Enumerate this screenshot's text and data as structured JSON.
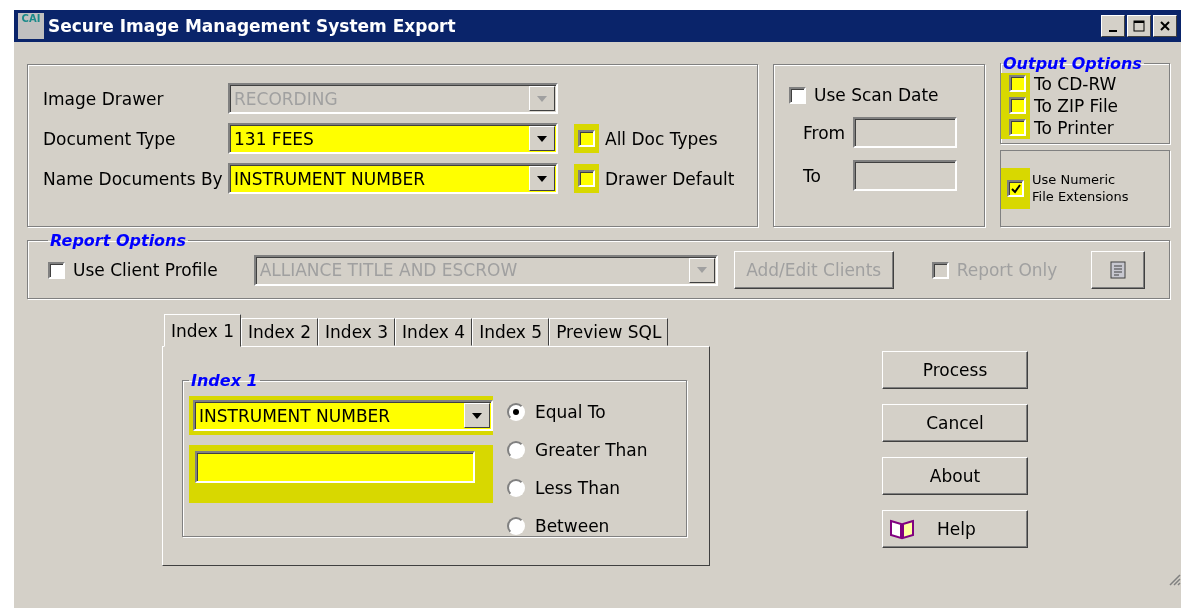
{
  "window": {
    "title": "Secure Image Management System Export",
    "app_icon_text": "CAI"
  },
  "document_fields": [
    {
      "label": "Image Drawer",
      "value": "RECORDING",
      "disabled": true,
      "highlighted": false
    },
    {
      "label": "Document Type",
      "value": "131 FEES",
      "disabled": false,
      "highlighted": true,
      "checkbox": {
        "label": "All Doc Types",
        "checked": false,
        "highlighted": true
      }
    },
    {
      "label": "Name Documents By",
      "value": "INSTRUMENT NUMBER",
      "disabled": false,
      "highlighted": true,
      "checkbox": {
        "label": "Drawer Default",
        "checked": false,
        "highlighted": true
      }
    }
  ],
  "scan_date": {
    "label": "Use Scan Date",
    "checked": false,
    "from_label": "From",
    "to_label": "To"
  },
  "output_options": {
    "title": "Output Options",
    "options": [
      {
        "label": "To CD-RW",
        "checked": false,
        "highlighted": true
      },
      {
        "label": "To ZIP File",
        "checked": false,
        "highlighted": true
      },
      {
        "label": "To Printer",
        "checked": false,
        "highlighted": true
      }
    ],
    "numeric_extensions": {
      "label": "Use Numeric File Extensions",
      "checked": true,
      "highlighted": true
    }
  },
  "report_options": {
    "title": "Report Options",
    "use_client_profile": {
      "label": "Use Client Profile",
      "checked": false,
      "disabled": false
    },
    "client": {
      "value": "ALLIANCE TITLE AND ESCROW",
      "disabled": true
    },
    "add_edit_button": {
      "label": "Add/Edit Clients",
      "disabled": true
    },
    "report_only": {
      "label": "Report Only",
      "checked": false,
      "disabled": true
    }
  },
  "tabs": [
    {
      "label": "Index 1",
      "selected": true
    },
    {
      "label": "Index 2",
      "selected": false
    },
    {
      "label": "Index 3",
      "selected": false
    },
    {
      "label": "Index 4",
      "selected": false
    },
    {
      "label": "Index 5",
      "selected": false
    },
    {
      "label": "Preview SQL",
      "selected": false
    }
  ],
  "index_group": {
    "title": "Index 1",
    "field": {
      "value": "INSTRUMENT NUMBER",
      "highlighted": true
    },
    "text_input": {
      "highlighted": true
    },
    "comparisons": [
      {
        "label": "Equal To",
        "selected": true
      },
      {
        "label": "Greater Than",
        "selected": false
      },
      {
        "label": "Less Than",
        "selected": false
      },
      {
        "label": "Between",
        "selected": false
      }
    ]
  },
  "buttons": [
    {
      "label": "Process",
      "kind": "plain"
    },
    {
      "label": "Cancel",
      "kind": "plain"
    },
    {
      "label": "About",
      "kind": "plain"
    },
    {
      "label": "Help",
      "kind": "help"
    }
  ]
}
